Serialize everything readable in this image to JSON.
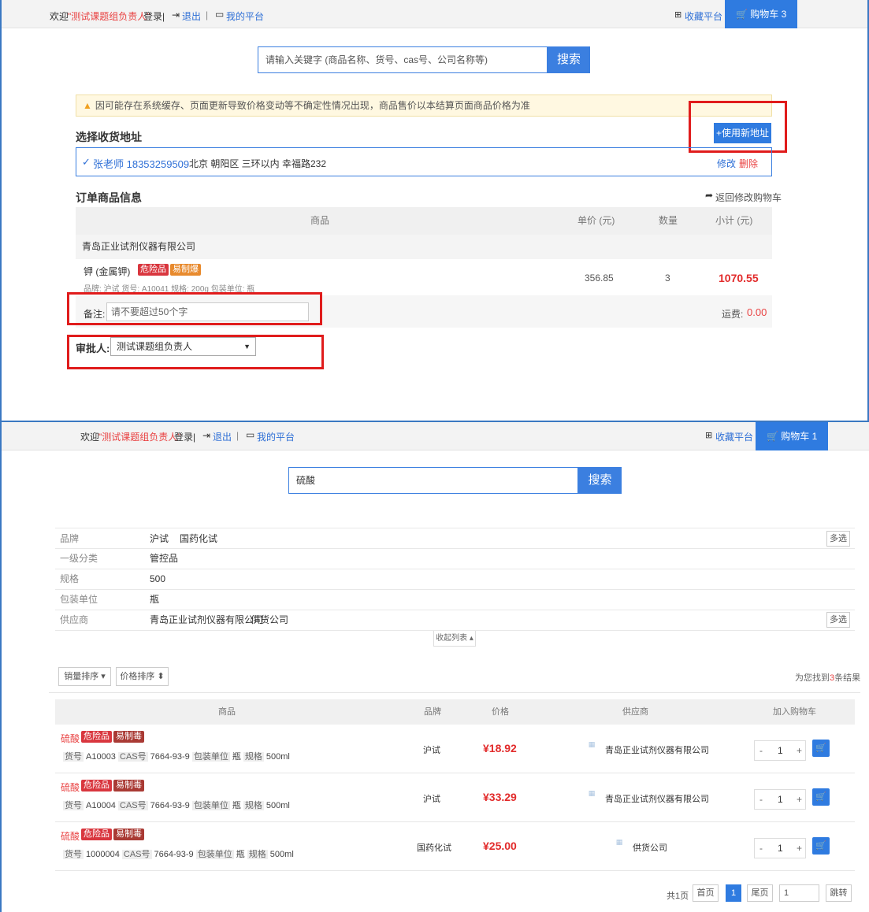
{
  "accent_color": "#2f7be0",
  "top": {
    "welcome": "欢迎",
    "user": "\"测试课题组负责人\"",
    "logged": "登录|",
    "logout": "退出",
    "sep": "|",
    "platform": "我的平台",
    "favorites": "收藏平台"
  },
  "checkout": {
    "cart": "购物车 3 件",
    "search_placeholder": "请输入关键字 (商品名称、货号、cas号、公司名称等)",
    "search_button": "搜索",
    "notice": "因可能存在系统缓存、页面更新导致价格变动等不确定性情况出现，商品售价以本结算页面商品价格为准",
    "address_title": "选择收货地址",
    "new_address": "+使用新地址",
    "address_check": "✓",
    "address_name": "张老师 18353259509",
    "address_detail": "北京 朝阳区 三环以内 幸福路232",
    "edit": "修改",
    "delete": "删除",
    "order_title": "订单商品信息",
    "back_to_cart": "返回修改购物车",
    "headers": {
      "product": "商品",
      "unit_price": "单价 (元)",
      "quantity": "数量",
      "subtotal": "小计 (元)"
    },
    "supplier": "青岛正业试剂仪器有限公司",
    "item": {
      "name": "钾 (金属钾)",
      "tag1": "危险品",
      "tag2": "易制爆",
      "meta": "品牌: 沪试   货号: A10041   规格: 200g   包装单位: 瓶",
      "unit_price": "356.85",
      "quantity": "3",
      "subtotal": "1070.55"
    },
    "remark_label": "备注:",
    "remark_placeholder": "请不要超过50个字",
    "shipping_label": "运费:",
    "shipping_value": "0.00",
    "approver_label": "审批人:",
    "approver_value": "测试课题组负责人",
    "approver_arrow": "▼"
  },
  "search": {
    "cart": "购物车 1 件",
    "query": "硫酸",
    "search_button": "搜索",
    "filters": [
      {
        "label": "品牌",
        "values": [
          "沪试",
          "国药化试"
        ],
        "more": "多选"
      },
      {
        "label": "一级分类",
        "values": [
          "管控品"
        ],
        "more": ""
      },
      {
        "label": "规格",
        "values": [
          "500"
        ],
        "more": ""
      },
      {
        "label": "包装单位",
        "values": [
          "瓶"
        ],
        "more": ""
      },
      {
        "label": "供应商",
        "values": [
          "青岛正业试剂仪器有限公司",
          "供货公司"
        ],
        "more": "多选"
      }
    ],
    "collapse": "收起列表 ▴",
    "sort_sales": "销量排序 ▾",
    "sort_price": "价格排序 ⬍",
    "result_prefix": "为您找到",
    "result_count": "3",
    "result_suffix": "条结果",
    "headers": {
      "product": "商品",
      "brand": "品牌",
      "price": "价格",
      "supplier": "供应商",
      "add_cart": "加入购物车"
    },
    "products": [
      {
        "name": "硫酸",
        "tag1": "危险品",
        "tag2": "易制毒",
        "sku_label": "货号",
        "sku": "A10003",
        "cas_label": "CAS号",
        "cas": "7664-93-9",
        "pack_label": "包装单位",
        "pack": "瓶",
        "spec_label": "规格",
        "spec": "500ml",
        "brand": "沪试",
        "price": "¥18.92",
        "supplier": "青岛正业试剂仪器有限公司",
        "qty": "1"
      },
      {
        "name": "硫酸",
        "tag1": "危险品",
        "tag2": "易制毒",
        "sku_label": "货号",
        "sku": "A10004",
        "cas_label": "CAS号",
        "cas": "7664-93-9",
        "pack_label": "包装单位",
        "pack": "瓶",
        "spec_label": "规格",
        "spec": "500ml",
        "brand": "沪试",
        "price": "¥33.29",
        "supplier": "青岛正业试剂仪器有限公司",
        "qty": "1"
      },
      {
        "name": "硫酸",
        "tag1": "危险品",
        "tag2": "易制毒",
        "sku_label": "货号",
        "sku": "1000004",
        "cas_label": "CAS号",
        "cas": "7664-93-9",
        "pack_label": "包装单位",
        "pack": "瓶",
        "spec_label": "规格",
        "spec": "500ml",
        "brand": "国药化试",
        "price": "¥25.00",
        "supplier": "供货公司",
        "qty": "1"
      }
    ],
    "pager": {
      "total": "共1页",
      "first": "首页",
      "current": "1",
      "last": "尾页",
      "jump_value": "1",
      "jump": "跳转"
    }
  }
}
